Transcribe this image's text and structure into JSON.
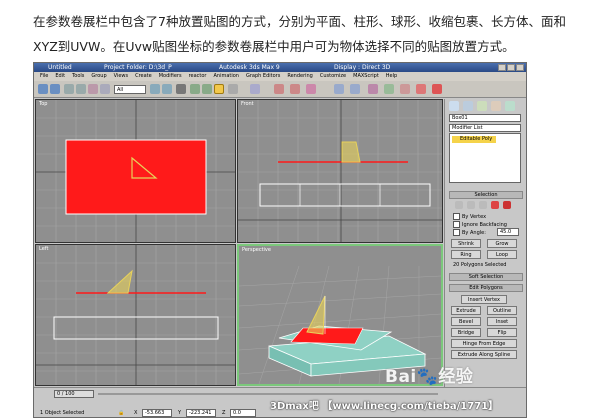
{
  "article": {
    "paragraph": "在参数卷展栏中包含了7种放置贴图的方式，分别为平面、柱形、球形、收缩包裹、长方体、面和XYZ到UVW。在Uvw贴图坐标的参数卷展栏中用户可为物体选择不同的贴图放置方式。"
  },
  "app": {
    "title_left": "Untitled",
    "title_project": "Project Folder: D:\\3d_P",
    "title_app": "Autodesk 3ds Max 9",
    "title_display": "Display : Direct 3D"
  },
  "menu": [
    "File",
    "Edit",
    "Tools",
    "Group",
    "Views",
    "Create",
    "Modifiers",
    "reactor",
    "Animation",
    "Graph Editors",
    "Rendering",
    "Customize",
    "MAXScript",
    "Help"
  ],
  "toolbar": {
    "selection_filter": "All"
  },
  "viewports": {
    "top": "Top",
    "front": "Front",
    "left": "Left",
    "perspective": "Perspective"
  },
  "command_panel": {
    "object_name": "Box01",
    "modifier_list": "Modifier List",
    "stack_item": "Editable Poly",
    "selection_rollout": "Selection",
    "by_vertex": "By Vertex",
    "ignore_backfacing": "Ignore Backfacing",
    "by_angle": "By Angle:",
    "by_angle_value": "45.0",
    "shrink": "Shrink",
    "grow": "Grow",
    "ring": "Ring",
    "loop": "Loop",
    "selected_info": "20 Polygons Selected",
    "soft_selection": "Soft Selection",
    "edit_polygons": "Edit Polygons",
    "insert_vertex": "Insert Vertex",
    "extrude": "Extrude",
    "outline": "Outline",
    "bevel": "Bevel",
    "inset": "Inset",
    "bridge": "Bridge",
    "flip": "Flip",
    "hinge_from_edge": "Hinge From Edge",
    "extrude_along_spline": "Extrude Along Spline"
  },
  "status": {
    "time": "0 / 100",
    "selection": "1 Object Selected",
    "x": "-53.663",
    "y": "-223.241",
    "z": "0.0"
  },
  "watermarks": {
    "baidu": "Bai🐾经验",
    "url": "3Dmax吧 【www.linecg.com/tieba/1771】"
  },
  "colors": {
    "plane_red": "#ff1a1a",
    "gizmo_yellow": "#e8d25a",
    "box_teal": "#8fd1c4",
    "active_border": "#7bc87b",
    "stack_highlight": "#f5d34a"
  }
}
